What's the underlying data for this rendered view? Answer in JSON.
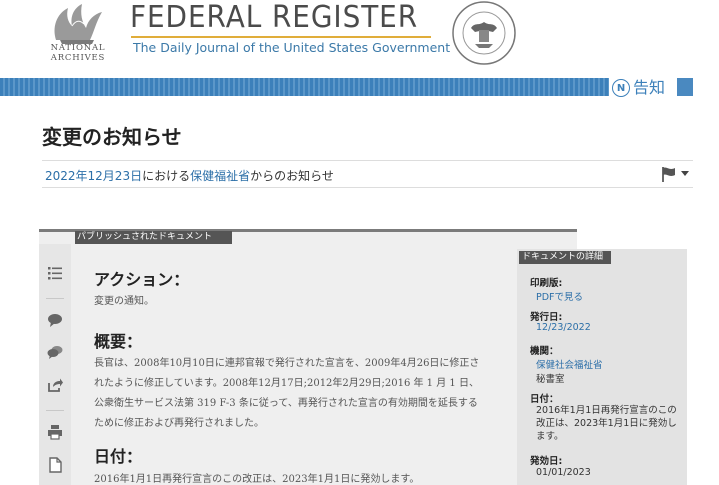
{
  "header": {
    "na_line1": "NATIONAL",
    "na_line2": "ARCHIVES",
    "title": "FEDERAL REGISTER",
    "subtitle": "The Daily Journal of the United States Government",
    "notice_letter": "N",
    "notice_label": "告知"
  },
  "page": {
    "title": "変更のお知らせ",
    "meta_date": "2022年12月23日",
    "meta_mid": "における",
    "meta_agency": "保健福祉省",
    "meta_end": "からのお知らせ"
  },
  "doc": {
    "tab_label": "パブリッシュされたドキュメント",
    "action_heading": "アクション：",
    "action_text": "変更の通知。",
    "summary_heading": "概要：",
    "summary_text": "長官は、2008年10月10日に連邦官報で発行された宣言を、2009年4月26日に修正されたように修正しています。2008年12月17日;2012年2月29日;2016 年 1 月 1 日、公衆衛生サービス法第 319 F-3 条に従って、再発行された宣言の有効期間を延長するために修正および再発行されました。",
    "dates_heading": "日付：",
    "dates_text": "2016年1月1日再発行宣言のこの改正は、2023年1月1日に発効します。"
  },
  "details": {
    "tab_label": "ドキュメントの詳細",
    "print_label": "印刷版:",
    "print_value": "PDFで見る",
    "published_label": "発行日:",
    "published_value": "12/23/2022",
    "agency_label": "機関：",
    "agency_value": "保健社会福祉省",
    "agency_sub": "秘書室",
    "dates_label": "日付：",
    "dates_value": "2016年1月1日再発行宣言のこの改正は、2023年1月1日に発効します。",
    "effective_label": "発効日:",
    "effective_value": "01/01/2023"
  },
  "colors": {
    "accent_blue": "#3c80ba",
    "link_blue": "#2c6fa8",
    "gold_rule": "#e0ad3a"
  }
}
